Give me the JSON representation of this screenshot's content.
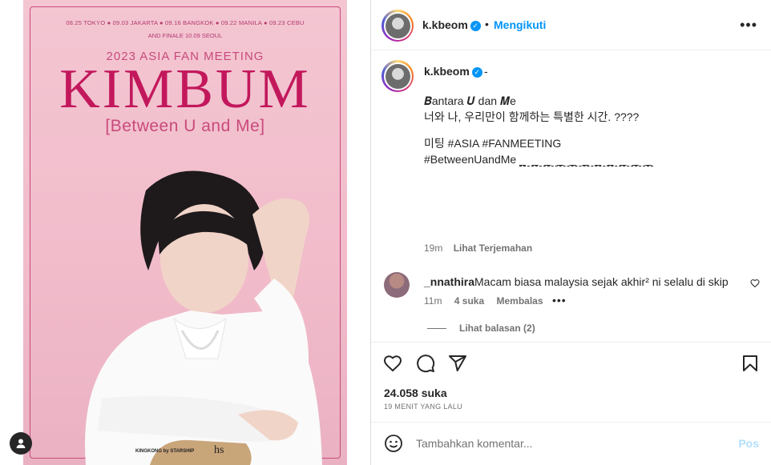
{
  "poster": {
    "dates": "08.25 TOKYO  ●  09.03 JAKARTA  ●  09.16 BANGKOK  ●  09.22 MANILA  ●  09.23 CEBU",
    "finale": "AND FINALE 10.09 SEOUL",
    "subtitle": "2023 ASIA FAN MEETING",
    "title": "KIMBUM",
    "tagline": "[Between U and Me]",
    "logo_left": "KINGKONG by STARSHIP",
    "logo_right": "hs"
  },
  "header": {
    "username": "k.kbeom",
    "separator": "•",
    "follow_status": "Mengikuti",
    "more": "•••"
  },
  "caption": {
    "username": "k.kbeom",
    "dash": "-",
    "lines": [
      "𝑩antara 𝑼 dan 𝑴e",
      "너와 나, 우리만이 함께하는 특별한 시간. ????",
      "미팅 #ASIA #FANMEETING",
      "#BetweenUandMe"
    ],
    "tail": "_ _ _ _ _ _ _ _ _ _ _",
    "time": "19m",
    "translate": "Lihat Terjemahan"
  },
  "comment": {
    "username": "_nnathira",
    "text": "Macam biasa malaysia sejak akhir² ni selalu di skip",
    "time": "11m",
    "likes": "4 suka",
    "reply": "Membalas",
    "dots": "•••",
    "view_replies": "Lihat balasan (2)"
  },
  "stats": {
    "likes": "24.058 suka",
    "time": "19 MENIT YANG LALU"
  },
  "add_comment": {
    "placeholder": "Tambahkan komentar...",
    "post": "Pos"
  },
  "colors": {
    "accent": "#0095f6",
    "poster_pink": "#f2bccb",
    "title_magenta": "#c2185b"
  },
  "icons": [
    "heart-icon",
    "comment-icon",
    "share-icon",
    "bookmark-icon",
    "emoji-icon",
    "verified-icon",
    "user-icon"
  ]
}
